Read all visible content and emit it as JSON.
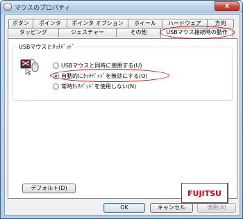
{
  "window": {
    "title": "マウスのプロパティ",
    "close_glyph": "x"
  },
  "tabs": {
    "row1": [
      "ボタン",
      "ポインタ",
      "ポインタ オプション",
      "ホイール",
      "ハードウェア",
      "方向"
    ],
    "row2": [
      "タッピング",
      "ジェスチャー",
      "その他",
      "USBマウス接続時の動作"
    ],
    "active": "USBマウス接続時の動作"
  },
  "group": {
    "label": "USBマウスとﾀｯﾁﾊﾟｯﾄﾞ",
    "icon": "touchpad-usb-mouse-icon",
    "options": [
      {
        "label": "USBマウスと同時に使用する(U)",
        "checked": false
      },
      {
        "label": "自動的にﾀｯﾁﾊﾟｯﾄﾞを無効にする(O)",
        "checked": true
      },
      {
        "label": "常時ﾀｯﾁﾊﾟｯﾄﾞを使用しない(N)",
        "checked": false
      }
    ]
  },
  "default_button": "デフォルト(D)",
  "logo": "FUJITSU",
  "buttons": {
    "ok": "OK",
    "cancel": "キャンセル",
    "apply": "適用(A)"
  },
  "colors": {
    "highlight": "#d80000",
    "logo": "#d0021b"
  }
}
